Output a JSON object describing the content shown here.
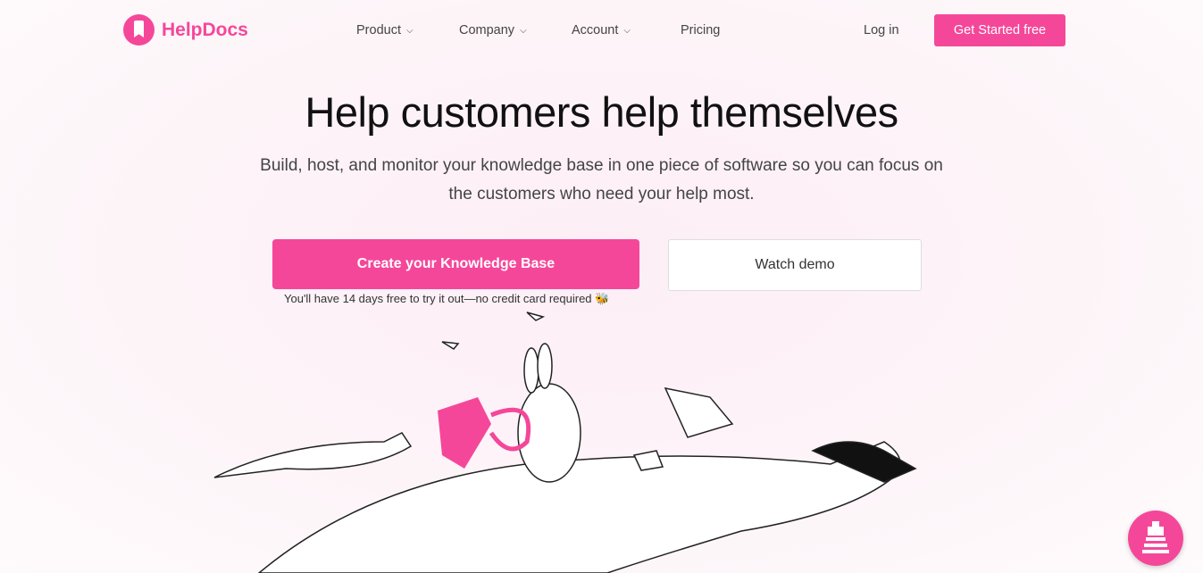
{
  "brand": {
    "name": "HelpDocs",
    "color": "#f5479a"
  },
  "nav": {
    "items": [
      {
        "label": "Product",
        "dropdown": true
      },
      {
        "label": "Company",
        "dropdown": true
      },
      {
        "label": "Account",
        "dropdown": true
      },
      {
        "label": "Pricing",
        "dropdown": false
      }
    ],
    "login": "Log in",
    "cta": "Get Started free"
  },
  "hero": {
    "title": "Help customers help themselves",
    "subtitle": "Build, host, and monitor your knowledge base in one piece of software so you can focus on the customers who need your help most.",
    "primary_button": "Create your Knowledge Base",
    "secondary_button": "Watch demo",
    "note": "You'll have 14 days free to try it out—no credit card required"
  },
  "chat": {
    "icon": "lighthouse-icon"
  }
}
